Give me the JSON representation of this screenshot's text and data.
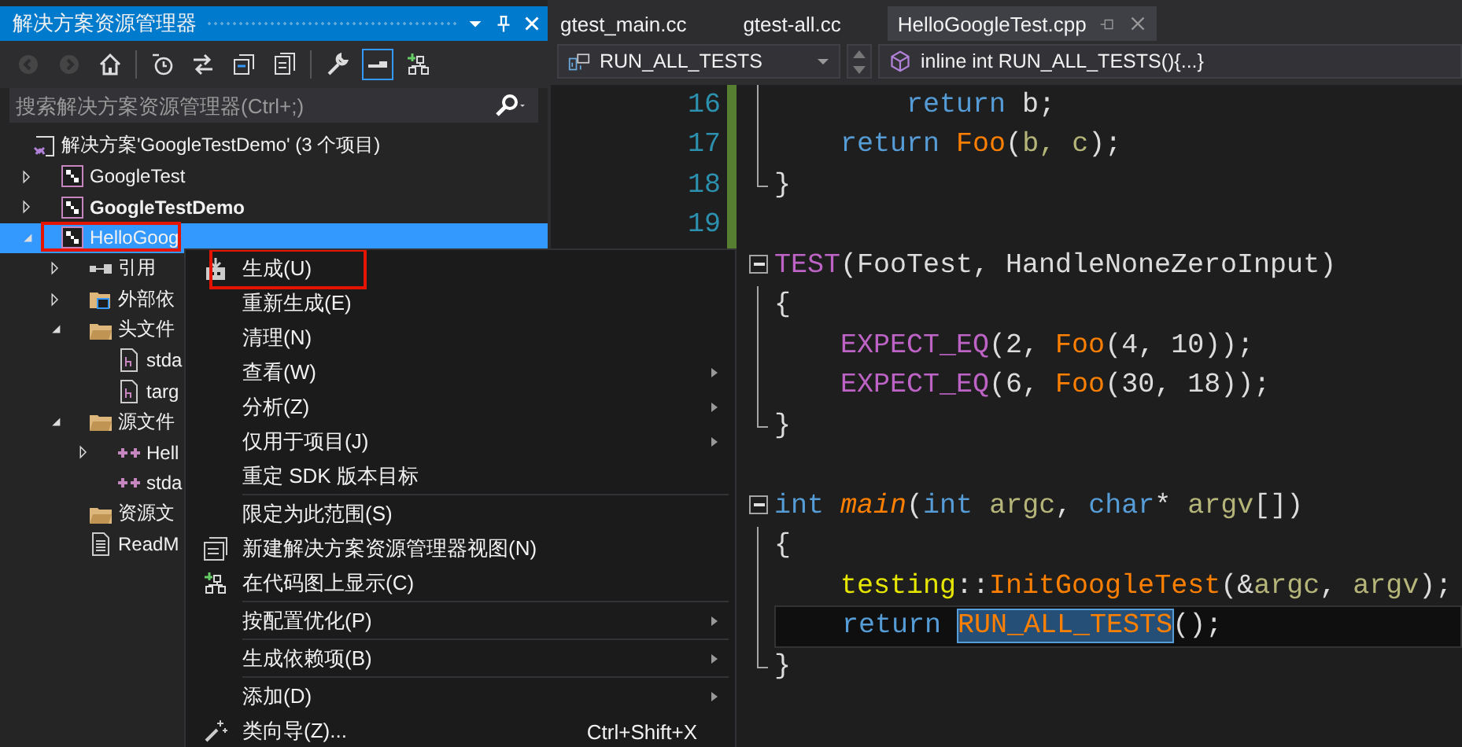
{
  "explorer": {
    "title": "解决方案资源管理器",
    "toolbar": [
      {
        "kind": "back",
        "disabled": true,
        "selected": false
      },
      {
        "kind": "forward",
        "disabled": true,
        "selected": false
      },
      {
        "kind": "home",
        "disabled": false,
        "selected": false
      },
      {
        "kind": "history",
        "disabled": false,
        "selected": false
      },
      {
        "kind": "sync",
        "disabled": false,
        "selected": false
      },
      {
        "kind": "collapse",
        "disabled": false,
        "selected": false
      },
      {
        "kind": "files",
        "disabled": false,
        "selected": false
      },
      {
        "kind": "wrench",
        "disabled": false,
        "selected": false
      },
      {
        "kind": "preview",
        "disabled": false,
        "selected": true
      },
      {
        "kind": "diagram",
        "disabled": false,
        "selected": false
      }
    ],
    "search": {
      "placeholder": "搜索解决方案资源管理器(Ctrl+;)"
    },
    "tree": [
      {
        "label": "解决方案'GoogleTestDemo' (3 个项目)",
        "kind": "solution",
        "selected": false,
        "bold": false,
        "annotated": false,
        "children": [
          {
            "label": "GoogleTest",
            "kind": "project",
            "expanded": false,
            "selected": false,
            "bold": false,
            "annotated": false
          },
          {
            "label": "GoogleTestDemo",
            "kind": "project",
            "expanded": false,
            "selected": false,
            "bold": true,
            "annotated": false
          },
          {
            "label": "HelloGoog",
            "kind": "project",
            "expanded": true,
            "selected": true,
            "bold": false,
            "annotated": true,
            "children": [
              {
                "label": "引用",
                "kind": "references",
                "expanded": false,
                "selected": false,
                "bold": false,
                "annotated": false
              },
              {
                "label": "外部依",
                "kind": "external",
                "expanded": false,
                "selected": false,
                "bold": false,
                "annotated": false
              },
              {
                "label": "头文件",
                "kind": "folder",
                "expanded": true,
                "selected": false,
                "bold": false,
                "annotated": false,
                "children": [
                  {
                    "label": "stda",
                    "kind": "header",
                    "selected": false,
                    "bold": false,
                    "annotated": false
                  },
                  {
                    "label": "targ",
                    "kind": "header",
                    "selected": false,
                    "bold": false,
                    "annotated": false
                  }
                ]
              },
              {
                "label": "源文件",
                "kind": "folder",
                "expanded": true,
                "selected": false,
                "bold": false,
                "annotated": false,
                "children": [
                  {
                    "label": "Hell",
                    "kind": "source",
                    "expanded": false,
                    "selected": false,
                    "bold": false,
                    "annotated": false
                  },
                  {
                    "label": "stda",
                    "kind": "source",
                    "selected": false,
                    "bold": false,
                    "annotated": false
                  }
                ]
              },
              {
                "label": "资源文",
                "kind": "folder",
                "selected": false,
                "bold": false,
                "annotated": false
              },
              {
                "label": "ReadM",
                "kind": "text",
                "selected": false,
                "bold": false,
                "annotated": false
              }
            ]
          }
        ]
      }
    ]
  },
  "editor": {
    "tabs": [
      {
        "label": "gtest_main.cc",
        "selected": false
      },
      {
        "label": "gtest-all.cc",
        "selected": false
      },
      {
        "label": "HelloGoogleTest.cpp",
        "selected": true
      }
    ],
    "scope": "RUN_ALL_TESTS",
    "member": "inline int RUN_ALL_TESTS(){...}",
    "lines": [
      {
        "number": "16",
        "kind": "line",
        "current": false,
        "tokens": [
          {
            "text": "        return",
            "kind": "keyword"
          },
          {
            "text": " b;",
            "kind": "plain"
          }
        ]
      },
      {
        "number": "17",
        "kind": "line",
        "current": false,
        "tokens": [
          {
            "text": "    return",
            "kind": "keyword"
          },
          {
            "text": " Foo",
            "kind": "function"
          },
          {
            "text": "(",
            "kind": "plain"
          },
          {
            "text": "b, c",
            "kind": "param"
          },
          {
            "text": ");",
            "kind": "plain"
          }
        ]
      },
      {
        "number": "18",
        "kind": "end",
        "current": false,
        "tokens": [
          {
            "text": "}",
            "kind": "plain"
          }
        ]
      },
      {
        "number": "19",
        "kind": "none",
        "current": false
      },
      {
        "kind": "fold",
        "current": false,
        "tokens": [
          {
            "text": "TEST",
            "kind": "macro"
          },
          {
            "text": "(FooTest, HandleNoneZeroInput)",
            "kind": "plain"
          }
        ]
      },
      {
        "kind": "line",
        "current": false,
        "tokens": [
          {
            "text": "{",
            "kind": "plain"
          }
        ]
      },
      {
        "kind": "line",
        "current": false,
        "tokens": [
          {
            "text": "    EXPECT_EQ",
            "kind": "macro"
          },
          {
            "text": "(2, ",
            "kind": "plain"
          },
          {
            "text": "Foo",
            "kind": "function"
          },
          {
            "text": "(4, 10));",
            "kind": "plain"
          }
        ]
      },
      {
        "kind": "line",
        "current": false,
        "tokens": [
          {
            "text": "    EXPECT_EQ",
            "kind": "macro"
          },
          {
            "text": "(6, ",
            "kind": "plain"
          },
          {
            "text": "Foo",
            "kind": "function"
          },
          {
            "text": "(30, 18));",
            "kind": "plain"
          }
        ]
      },
      {
        "kind": "end",
        "current": false,
        "tokens": [
          {
            "text": "}",
            "kind": "plain"
          }
        ]
      },
      {
        "kind": "none",
        "current": false
      },
      {
        "kind": "fold",
        "current": false,
        "tokens": [
          {
            "text": "int",
            "kind": "keyword"
          },
          {
            "text": " main",
            "kind": "entry"
          },
          {
            "text": "(",
            "kind": "plain"
          },
          {
            "text": "int",
            "kind": "keyword"
          },
          {
            "text": " argc",
            "kind": "param"
          },
          {
            "text": ", ",
            "kind": "plain"
          },
          {
            "text": "char",
            "kind": "keyword"
          },
          {
            "text": "* ",
            "kind": "plain"
          },
          {
            "text": "argv",
            "kind": "param"
          },
          {
            "text": "[])",
            "kind": "plain"
          }
        ]
      },
      {
        "kind": "line",
        "current": false,
        "tokens": [
          {
            "text": "{",
            "kind": "plain"
          }
        ]
      },
      {
        "kind": "line",
        "current": false,
        "tokens": [
          {
            "text": "    testing",
            "kind": "namespace"
          },
          {
            "text": "::",
            "kind": "plain"
          },
          {
            "text": "InitGoogleTest",
            "kind": "function"
          },
          {
            "text": "(&",
            "kind": "plain"
          },
          {
            "text": "argc",
            "kind": "param"
          },
          {
            "text": ", ",
            "kind": "plain"
          },
          {
            "text": "argv",
            "kind": "param"
          },
          {
            "text": ");",
            "kind": "plain"
          }
        ]
      },
      {
        "kind": "line",
        "current": true,
        "tokens": [
          {
            "text": "    return ",
            "kind": "keyword"
          },
          {
            "text": "RUN_ALL_TESTS",
            "kind": "match"
          },
          {
            "text": "();",
            "kind": "plain"
          }
        ]
      },
      {
        "kind": "end",
        "current": false,
        "tokens": [
          {
            "text": "}",
            "kind": "plain"
          }
        ]
      }
    ]
  },
  "context_menu": {
    "items": [
      {
        "kind": "build",
        "label": "生成(U)",
        "submenu": false,
        "annotated": true
      },
      {
        "kind": "item",
        "label": "重新生成(E)",
        "submenu": false,
        "annotated": false
      },
      {
        "kind": "item",
        "label": "清理(N)",
        "submenu": false,
        "annotated": false
      },
      {
        "kind": "item",
        "label": "查看(W)",
        "submenu": true,
        "annotated": false
      },
      {
        "kind": "item",
        "label": "分析(Z)",
        "submenu": true,
        "annotated": false
      },
      {
        "kind": "item",
        "label": "仅用于项目(J)",
        "submenu": true,
        "annotated": false
      },
      {
        "kind": "item",
        "label": "重定 SDK 版本目标",
        "submenu": false,
        "annotated": false
      },
      {
        "kind": "separator"
      },
      {
        "kind": "item",
        "label": "限定为此范围(S)",
        "submenu": false,
        "annotated": false
      },
      {
        "kind": "view",
        "label": "新建解决方案资源管理器视图(N)",
        "submenu": false,
        "annotated": false
      },
      {
        "kind": "diagram",
        "label": "在代码图上显示(C)",
        "submenu": false,
        "annotated": false
      },
      {
        "kind": "separator"
      },
      {
        "kind": "item",
        "label": "按配置优化(P)",
        "submenu": true,
        "annotated": false
      },
      {
        "kind": "separator"
      },
      {
        "kind": "item",
        "label": "生成依赖项(B)",
        "submenu": true,
        "annotated": false
      },
      {
        "kind": "separator"
      },
      {
        "kind": "item",
        "label": "添加(D)",
        "submenu": true,
        "annotated": false
      },
      {
        "kind": "wizard",
        "label": "类向导(Z)...",
        "submenu": false,
        "annotated": false,
        "shortcut": "Ctrl+Shift+X"
      }
    ]
  }
}
